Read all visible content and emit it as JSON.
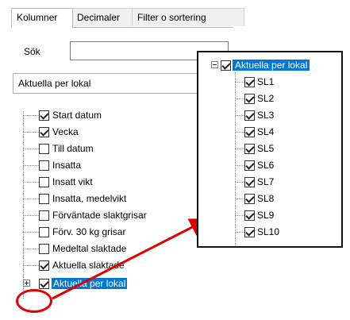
{
  "tabs": [
    "Kolumner",
    "Decimaler",
    "Filter o sortering"
  ],
  "search": {
    "label": "Sök",
    "value": ""
  },
  "view_select": {
    "value": "Aktuella per lokal"
  },
  "tree": {
    "items": [
      {
        "label": "Start datum",
        "checked": true
      },
      {
        "label": "Vecka",
        "checked": true
      },
      {
        "label": "Till datum",
        "checked": false
      },
      {
        "label": "Insatta",
        "checked": false
      },
      {
        "label": "Insatt vikt",
        "checked": false
      },
      {
        "label": "Insatta, medelvikt",
        "checked": false
      },
      {
        "label": "Förväntade slaktgrisar",
        "checked": false
      },
      {
        "label": "Förv. 30 kg grisar",
        "checked": false
      },
      {
        "label": "Medeltal slaktade",
        "checked": false
      },
      {
        "label": "Aktuella slaktade",
        "checked": true
      },
      {
        "label": "Aktuella per lokal",
        "checked": true,
        "selected": true,
        "collapsed": true
      }
    ]
  },
  "zoom": {
    "root_label": "Aktuella per lokal",
    "children": [
      "SL1",
      "SL2",
      "SL3",
      "SL4",
      "SL5",
      "SL6",
      "SL7",
      "SL8",
      "SL9",
      "SL10"
    ]
  },
  "colors": {
    "selection": "#0078d7",
    "annotation": "#e00000"
  }
}
